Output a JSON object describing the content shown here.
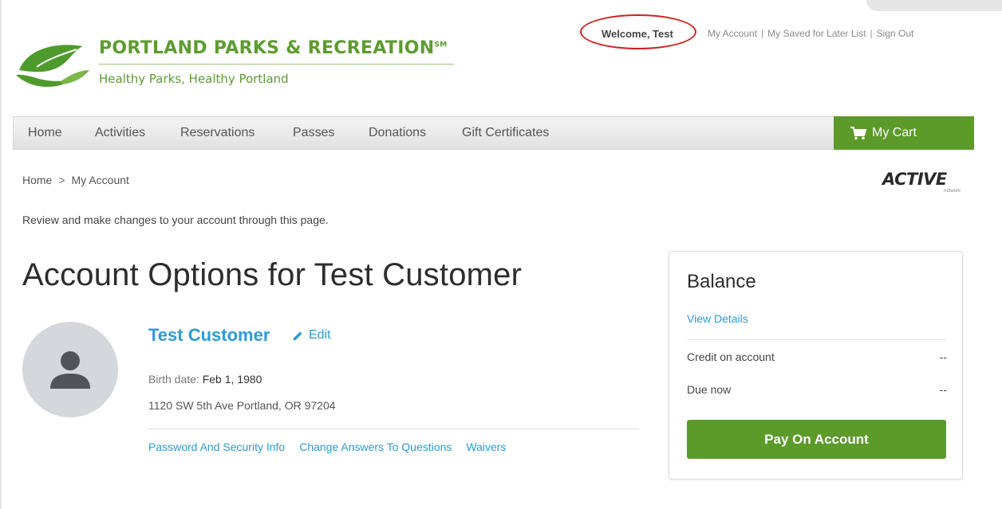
{
  "header": {
    "logo": {
      "title": "PORTLAND PARKS & RECREATION",
      "trademark": "SM",
      "tagline": "Healthy Parks, Healthy Portland"
    },
    "welcome": "Welcome, Test",
    "links": [
      "My Account",
      "My Saved for Later List",
      "Sign Out"
    ],
    "link_separator": "|"
  },
  "nav": {
    "items": [
      "Home",
      "Activities",
      "Reservations",
      "Passes",
      "Donations",
      "Gift Certificates"
    ],
    "cart_label": "My Cart"
  },
  "breadcrumb": {
    "items": [
      "Home",
      "My Account"
    ],
    "separator": ">"
  },
  "branding": {
    "active_word": "ACTIVE",
    "active_sub": "network"
  },
  "intro": "Review and make changes to your account through this page.",
  "page_title": "Account Options for Test Customer",
  "profile": {
    "name": "Test Customer",
    "edit_label": "Edit",
    "birth_label": "Birth date:",
    "birth_value": "Feb 1, 1980",
    "address": "1120 SW 5th Ave Portland, OR 97204",
    "links": [
      "Password And Security Info",
      "Change Answers To Questions",
      "Waivers"
    ]
  },
  "balance": {
    "title": "Balance",
    "view_details": "View Details",
    "credit_label": "Credit on account",
    "credit_value": "--",
    "due_label": "Due now",
    "due_value": "--",
    "pay_label": "Pay On Account"
  },
  "colors": {
    "brand_green": "#5c9a2a",
    "link_blue": "#2e9bd5",
    "highlight_red": "#d21e1e"
  },
  "icons": {
    "logo": "leaf-hands-logo",
    "cart": "cart-icon",
    "edit": "pencil-icon",
    "avatar": "user-silhouette-icon"
  }
}
